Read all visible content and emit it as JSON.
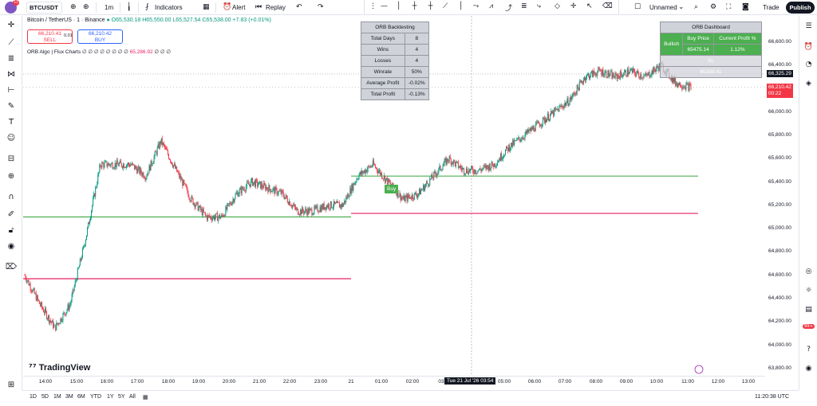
{
  "topbar": {
    "avatar_badge": "11",
    "symbol": "BTCUSDT",
    "interval": "1m",
    "indicators_label": "Indicators",
    "alert_label": "Alert",
    "replay_label": "Replay",
    "layout_name": "Unnamed",
    "trade_label": "Trade",
    "publish_label": "Publish"
  },
  "legend": {
    "title": "Bitcoin / TetherUS · 1 · Binance",
    "open": "O65,530.18",
    "high": "H65,550.00",
    "low": "L65,527.54",
    "close": "C65,538.00",
    "change": "+7.83 (+0.01%)"
  },
  "trading": {
    "sell_price": "66,210.41",
    "sell_label": "SELL",
    "spread": "0.01",
    "buy_price": "66,210.42",
    "buy_label": "BUY"
  },
  "indicator": {
    "name": "ORB Algo | Flux Charts",
    "values": "∅ ∅ ∅ ∅ ∅ ∅ ∅ ∅",
    "price": "65,286.92",
    "trail": "∅ ∅ ∅"
  },
  "orb_backtesting": {
    "title": "ORB Backtesting",
    "rows": [
      {
        "label": "Total Days",
        "value": "8"
      },
      {
        "label": "Wins",
        "value": "4"
      },
      {
        "label": "Losses",
        "value": "4"
      },
      {
        "label": "Winrate",
        "value": "50%"
      },
      {
        "label": "Average Profit",
        "value": "-0.02%"
      },
      {
        "label": "Total Profit",
        "value": "-0.13%"
      }
    ]
  },
  "orb_dashboard": {
    "title": "ORB Dashboard",
    "bias": "Bullish",
    "buy_price_label": "Buy Price",
    "current_profit_label": "Current Profit %",
    "buy_price": "65475.14",
    "current_profit": "1.12%",
    "sl_label": "SL",
    "sl_value": "65299.41"
  },
  "chart_labels": {
    "buy_tag": "Buy",
    "crosshair_date": "Tue 21 Jul '26",
    "crosshair_time": "03:54",
    "brand": "TradingView"
  },
  "price_axis": {
    "ticks": [
      "66,600.00",
      "66,400.00",
      "66,200.00",
      "66,000.00",
      "65,800.00",
      "65,600.00",
      "65,400.00",
      "65,200.00",
      "65,000.00",
      "64,800.00",
      "64,600.00",
      "64,400.00",
      "64,200.00",
      "64,000.00",
      "63,800.00"
    ],
    "current_price_tag": "66,325.29",
    "last_price_tag": "66,210.42",
    "countdown": "00:22"
  },
  "time_axis": {
    "ticks": [
      "14:00",
      "15:00",
      "16:00",
      "17:00",
      "18:00",
      "19:00",
      "20:00",
      "21:00",
      "22:00",
      "23:00",
      "21",
      "01:00",
      "02:00",
      "03",
      "05:00",
      "06:00",
      "07:00",
      "08:00",
      "09:00",
      "10:00",
      "11:00",
      "12:00",
      "13:00"
    ]
  },
  "bottombar": {
    "ranges": [
      "1D",
      "5D",
      "1M",
      "3M",
      "6M",
      "YTD",
      "1Y",
      "5Y",
      "All"
    ],
    "clock": "11:20:38 UTC"
  },
  "right_badge": "99+",
  "colors": {
    "up": "#089981",
    "down": "#f23645",
    "candle_body": "#131722",
    "green_level": "#4caf50",
    "red_level": "#e91e63",
    "dashboard_green": "#4caf50",
    "orb_grey": "#cfd2d9"
  },
  "chart_data": {
    "type": "candlestick",
    "x_label": "",
    "y_label": "",
    "ylim": [
      63800,
      66700
    ],
    "x": [
      "13:30",
      "14:00",
      "14:30",
      "15:00",
      "15:30",
      "16:00",
      "16:30",
      "17:00",
      "17:30",
      "18:00",
      "18:30",
      "19:00",
      "19:30",
      "20:00",
      "20:30",
      "21:00",
      "21:30",
      "22:00",
      "22:30",
      "23:00",
      "23:30",
      "00:00",
      "00:30",
      "01:00",
      "01:30",
      "02:00",
      "02:30",
      "03:00",
      "03:30",
      "04:00",
      "04:30",
      "05:00",
      "05:30",
      "06:00",
      "06:30",
      "07:00",
      "07:30",
      "08:00",
      "08:30",
      "09:00",
      "09:30",
      "10:00",
      "10:30",
      "11:00",
      "11:20"
    ],
    "close": [
      64600,
      64350,
      64150,
      64350,
      64900,
      65550,
      65550,
      65550,
      65450,
      65750,
      65500,
      65250,
      65100,
      65100,
      65300,
      65400,
      65350,
      65300,
      65150,
      65150,
      65200,
      65200,
      65450,
      65550,
      65400,
      65250,
      65300,
      65450,
      65600,
      65500,
      65500,
      65550,
      65700,
      65800,
      65900,
      66000,
      66100,
      66300,
      66350,
      66300,
      66350,
      66300,
      66400,
      66250,
      66210
    ],
    "levels": [
      {
        "name": "orb_high_day1",
        "price": 65100,
        "color": "green"
      },
      {
        "name": "orb_low_day1",
        "price": 64570,
        "color": "red"
      },
      {
        "name": "orb_high_day2",
        "price": 65450,
        "color": "green"
      },
      {
        "name": "orb_low_day2",
        "price": 65130,
        "color": "red"
      }
    ]
  }
}
